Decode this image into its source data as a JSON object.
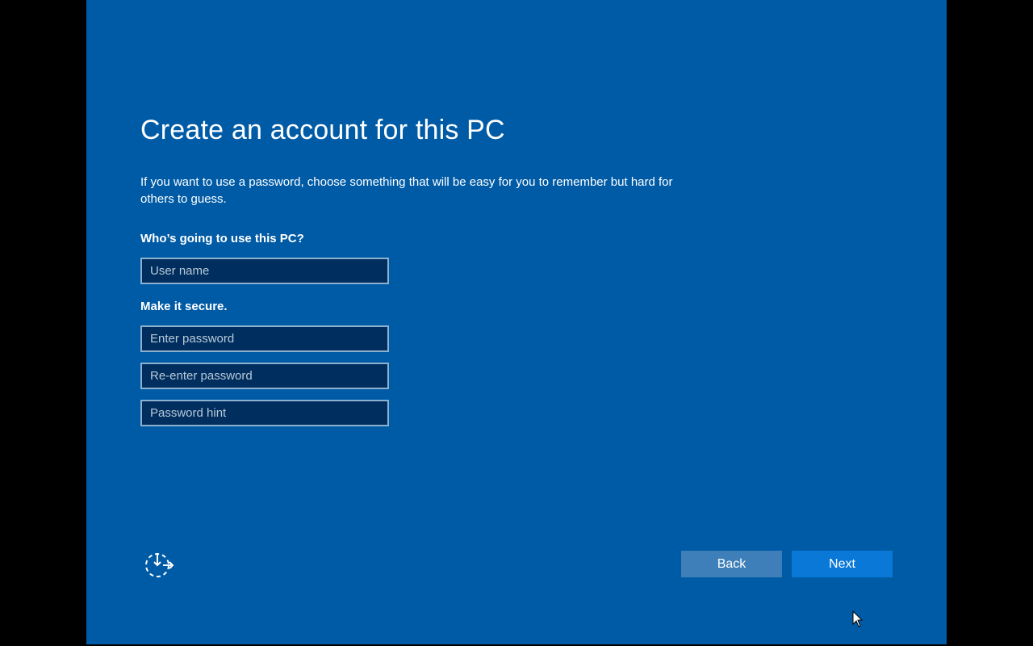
{
  "page": {
    "title": "Create an account for this PC",
    "description": "If you want to use a password, choose something that will be easy for you to remember but hard for others to guess."
  },
  "form": {
    "who_label": "Who’s going to use this PC?",
    "username_placeholder": "User name",
    "secure_label": "Make it secure.",
    "password_placeholder": "Enter password",
    "reenter_placeholder": "Re-enter password",
    "hint_placeholder": "Password hint"
  },
  "footer": {
    "ease_of_access_icon": "ease-of-access-icon",
    "back_label": "Back",
    "next_label": "Next"
  },
  "colors": {
    "background": "#005ba6",
    "back_button": "#3f7fb9",
    "next_button": "#0a78d7",
    "field_background": "#002f5f"
  }
}
